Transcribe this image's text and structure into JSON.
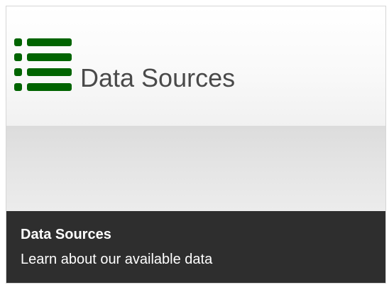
{
  "tile": {
    "header_title": "Data Sources",
    "icon": "list-icon",
    "accent_color": "#006400",
    "footer_title": "Data Sources",
    "footer_description": "Learn about our available data"
  }
}
